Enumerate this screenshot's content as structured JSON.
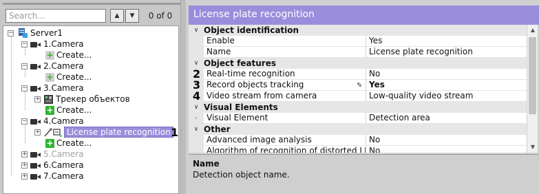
{
  "search": {
    "placeholder": "Search...",
    "value": "",
    "count": "0 of 0",
    "prev_icon": "chevron-up-icon",
    "next_icon": "chevron-down-icon"
  },
  "tree": {
    "server": "Server1",
    "nodes": [
      {
        "label": "1.Camera",
        "child": "Create..."
      },
      {
        "label": "2.Camera",
        "child": "Create..."
      },
      {
        "label": "3.Camera",
        "children": [
          "Трекер объектов",
          "Create..."
        ]
      },
      {
        "label": "4.Camera",
        "children": [
          "License plate recognition",
          "Create..."
        ]
      },
      {
        "label": "5.Camera",
        "disabled": true
      },
      {
        "label": "6.Camera"
      },
      {
        "label": "7.Camera"
      }
    ]
  },
  "annotations": [
    "1",
    "2",
    "3",
    "4"
  ],
  "properties": {
    "header": "License plate recognition",
    "categories": [
      {
        "title": "Object identification",
        "rows": [
          {
            "name": "Enable",
            "value": "Yes"
          },
          {
            "name": "Name",
            "value": "License plate recognition"
          }
        ]
      },
      {
        "title": "Object features",
        "rows": [
          {
            "name": "Real-time recognition",
            "value": "No"
          },
          {
            "name": "Record objects tracking",
            "value": "Yes"
          },
          {
            "name": "Video stream from camera",
            "value": "Low-quality video stream"
          }
        ]
      },
      {
        "title": "Visual Elements",
        "rows": [
          {
            "name": "Visual Element",
            "value": "Detection area"
          }
        ]
      },
      {
        "title": "Other",
        "rows": [
          {
            "name": "Advanced image analysis",
            "value": "No"
          },
          {
            "name": "Algorithm of recognition of distorted LP in",
            "value": "No"
          }
        ]
      }
    ],
    "description": {
      "title": "Name",
      "text": "Detection object name."
    }
  },
  "colors": {
    "accent": "#9a8ddc",
    "add_icon": "#2fb42f",
    "panel_bg": "#c8c8c8"
  }
}
